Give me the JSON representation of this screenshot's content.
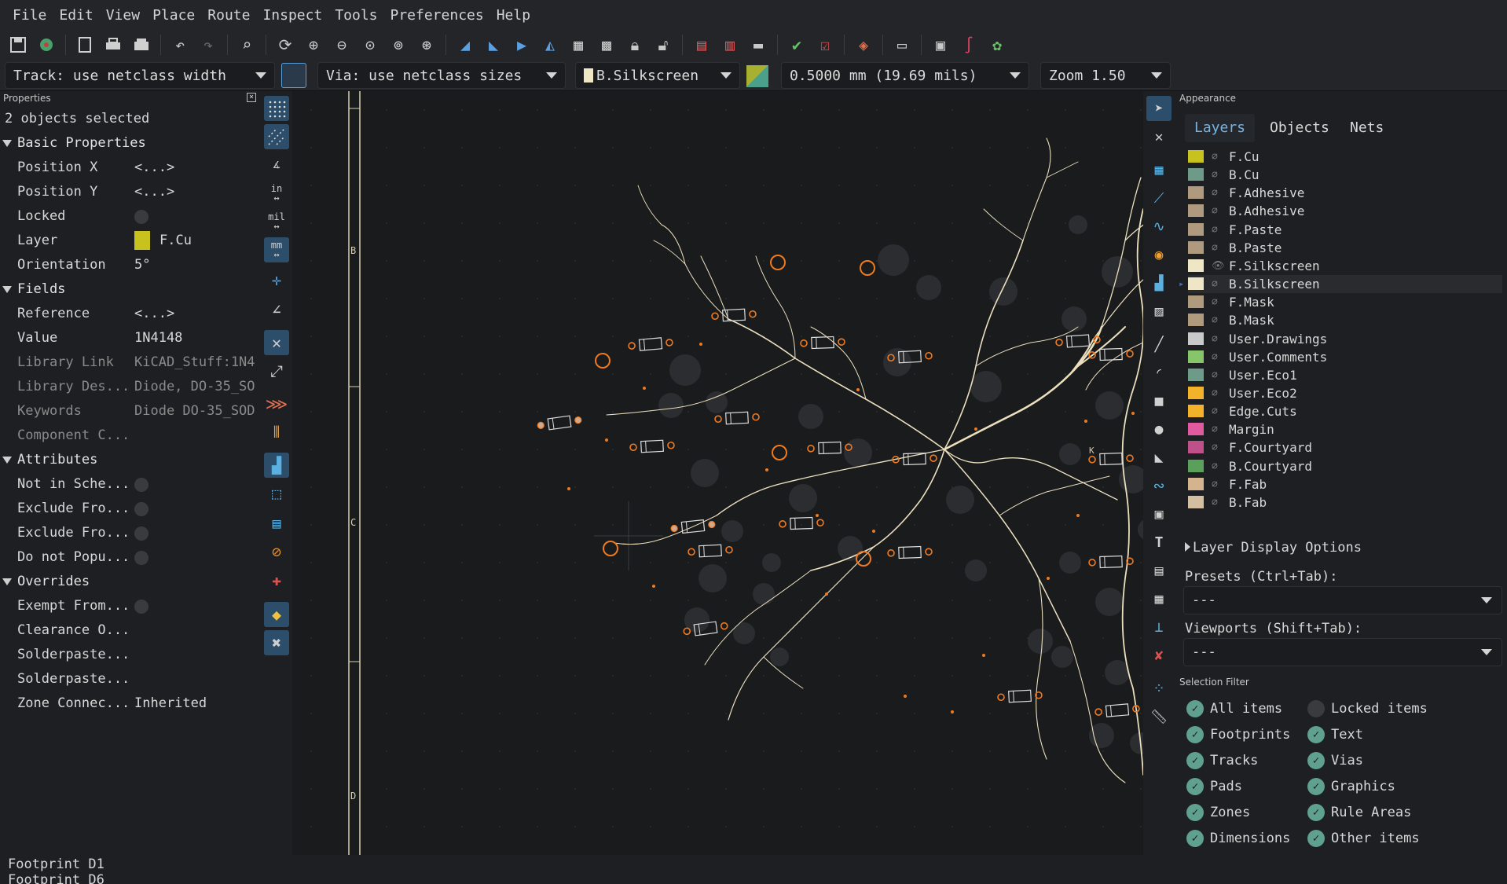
{
  "menu": [
    "File",
    "Edit",
    "View",
    "Place",
    "Route",
    "Inspect",
    "Tools",
    "Preferences",
    "Help"
  ],
  "optbar": {
    "track": "Track: use netclass width",
    "via": "Via: use netclass sizes",
    "layer": "B.Silkscreen",
    "grid": "0.5000 mm (19.69 mils)",
    "zoom": "Zoom 1.50"
  },
  "properties": {
    "title": "Properties",
    "summary": "2 objects selected",
    "basic": {
      "header": "Basic Properties",
      "position_x": {
        "label": "Position X",
        "value": "<...>"
      },
      "position_y": {
        "label": "Position Y",
        "value": "<...>"
      },
      "locked": {
        "label": "Locked"
      },
      "layer": {
        "label": "Layer",
        "value": "F.Cu"
      },
      "orientation": {
        "label": "Orientation",
        "value": "5°"
      }
    },
    "fields": {
      "header": "Fields",
      "reference": {
        "label": "Reference",
        "value": "<...>"
      },
      "value": {
        "label": "Value",
        "value": "1N4148"
      },
      "library_link": {
        "label": "Library Link",
        "value": "KiCAD_Stuff:1N4"
      },
      "library_desc": {
        "label": "Library Des...",
        "value": "Diode, DO-35_SO"
      },
      "keywords": {
        "label": "Keywords",
        "value": "Diode DO-35_SOD"
      },
      "component_class": {
        "label": "Component C..."
      }
    },
    "attributes": {
      "header": "Attributes",
      "not_in_schematic": "Not in Sche...",
      "exclude_from_1": "Exclude Fro...",
      "exclude_from_2": "Exclude Fro...",
      "do_not_populate": "Do not Popu..."
    },
    "overrides": {
      "header": "Overrides",
      "exempt_from": "Exempt From...",
      "clearance": "Clearance O...",
      "solderpaste_1": "Solderpaste...",
      "solderpaste_2": "Solderpaste...",
      "zone_connection": {
        "label": "Zone Connec...",
        "value": "Inherited"
      }
    }
  },
  "vtool_labels": {
    "inch": "in",
    "mil": "mil",
    "mm": "mm"
  },
  "ruler_letters": [
    "B",
    "C",
    "D"
  ],
  "canvas_annotation": "K",
  "appearance": {
    "title": "Appearance",
    "tabs": [
      "Layers",
      "Objects",
      "Nets"
    ],
    "layers": [
      {
        "name": "F.Cu",
        "color": "#c8c21e"
      },
      {
        "name": "B.Cu",
        "color": "#6e9a8a"
      },
      {
        "name": "F.Adhesive",
        "color": "#b09a7e"
      },
      {
        "name": "B.Adhesive",
        "color": "#b09a7e"
      },
      {
        "name": "F.Paste",
        "color": "#b09a7e"
      },
      {
        "name": "B.Paste",
        "color": "#b09a7e"
      },
      {
        "name": "F.Silkscreen",
        "color": "#efe6c6"
      },
      {
        "name": "B.Silkscreen",
        "color": "#efe6c6"
      },
      {
        "name": "F.Mask",
        "color": "#b09a7e"
      },
      {
        "name": "B.Mask",
        "color": "#b09a7e"
      },
      {
        "name": "User.Drawings",
        "color": "#c9c9c9"
      },
      {
        "name": "User.Comments",
        "color": "#86c56a"
      },
      {
        "name": "User.Eco1",
        "color": "#6e9a8a"
      },
      {
        "name": "User.Eco2",
        "color": "#f2b32a"
      },
      {
        "name": "Edge.Cuts",
        "color": "#f2b32a"
      },
      {
        "name": "Margin",
        "color": "#e05aa0"
      },
      {
        "name": "F.Courtyard",
        "color": "#c0508a"
      },
      {
        "name": "B.Courtyard",
        "color": "#5aa05a"
      },
      {
        "name": "F.Fab",
        "color": "#d4b48e"
      },
      {
        "name": "B.Fab",
        "color": "#d4c0a0"
      }
    ],
    "layer_display_options": "Layer Display Options",
    "presets_label": "Presets (Ctrl+Tab):",
    "presets_value": "---",
    "viewports_label": "Viewports (Shift+Tab):",
    "viewports_value": "---",
    "selection_filter": {
      "title": "Selection Filter",
      "items": [
        {
          "label": "All items",
          "checked": true
        },
        {
          "label": "Locked items",
          "checked": false
        },
        {
          "label": "Footprints",
          "checked": true
        },
        {
          "label": "Text",
          "checked": true
        },
        {
          "label": "Tracks",
          "checked": true
        },
        {
          "label": "Vias",
          "checked": true
        },
        {
          "label": "Pads",
          "checked": true
        },
        {
          "label": "Graphics",
          "checked": true
        },
        {
          "label": "Zones",
          "checked": true
        },
        {
          "label": "Rule Areas",
          "checked": true
        },
        {
          "label": "Dimensions",
          "checked": true
        },
        {
          "label": "Other items",
          "checked": true
        }
      ]
    }
  },
  "status": {
    "line1": "Footprint D1",
    "line2": "Footprint D6"
  },
  "colors": {
    "accent": "#7ab3e0",
    "silk": "#efe6c6",
    "pad": "#f07a1e"
  }
}
